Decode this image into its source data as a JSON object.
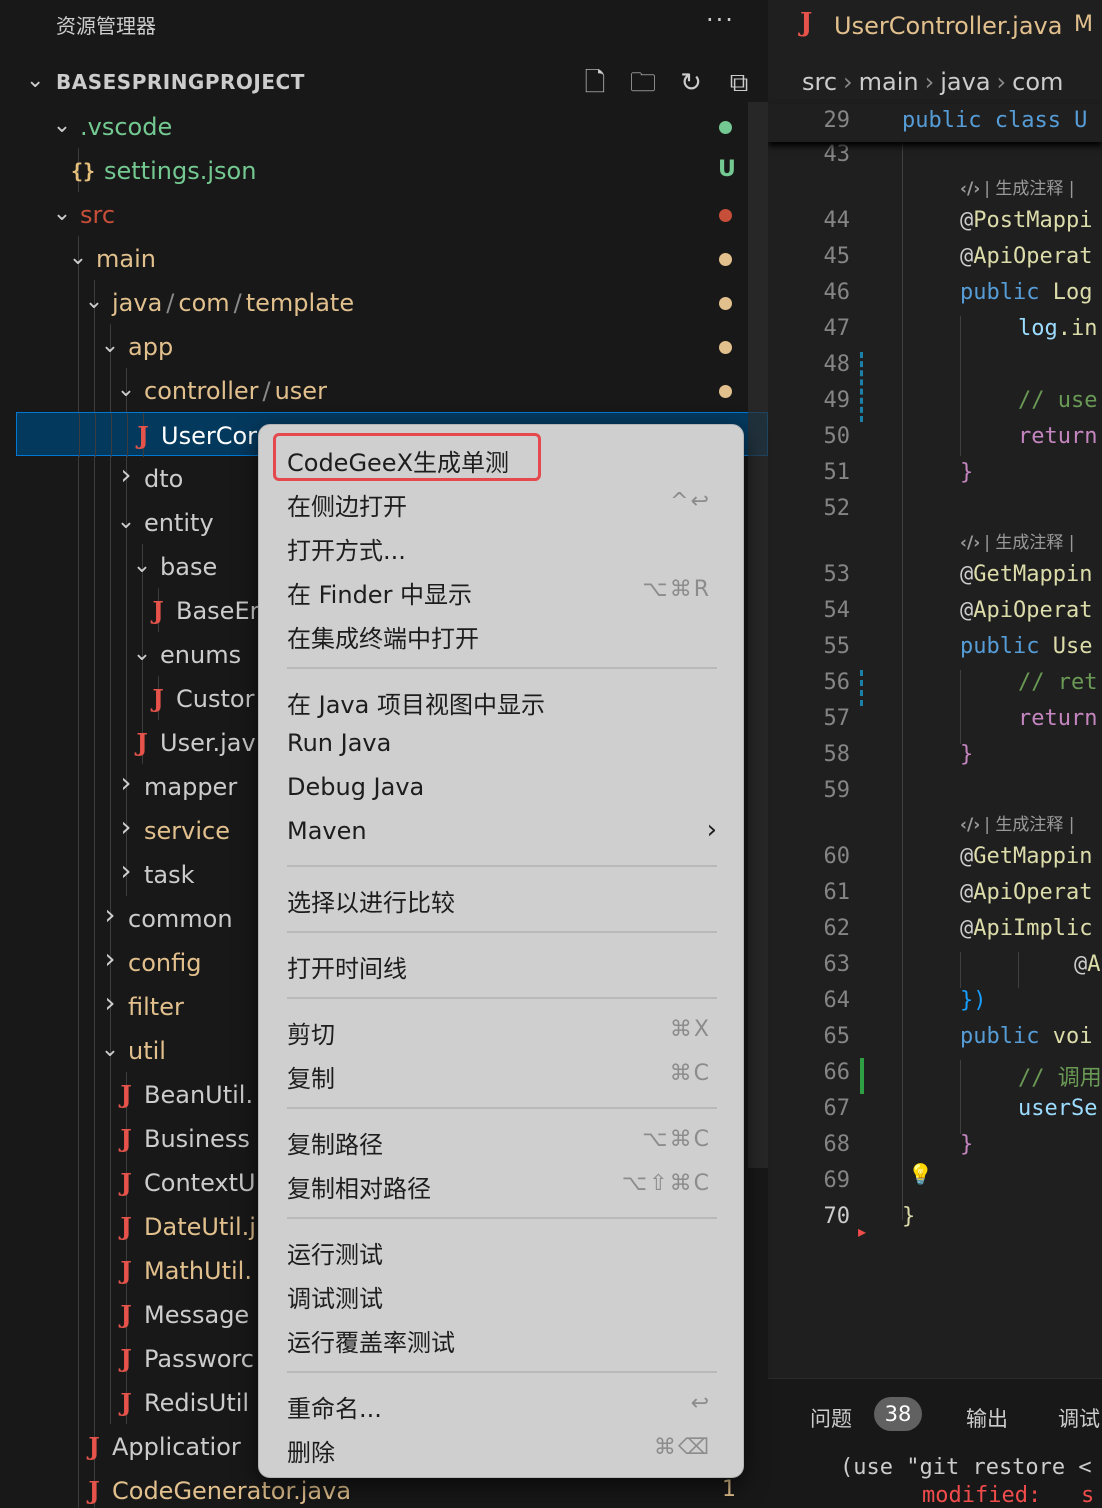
{
  "explorer": {
    "title": "资源管理器",
    "more": "···",
    "project": "BASESPRINGPROJECT",
    "actions": [
      "new-file-icon",
      "new-folder-icon",
      "refresh-icon",
      "collapse-all-icon"
    ],
    "tree": [
      {
        "label": ".vscode",
        "kind": "folder",
        "open": true,
        "status": "dot",
        "color": "#73c991"
      },
      {
        "label": "settings.json",
        "kind": "json",
        "status": "U",
        "color": "#73c991"
      },
      {
        "label": "src",
        "kind": "folder",
        "open": true,
        "status": "dot",
        "color": "#c74e39"
      },
      {
        "label": "main",
        "kind": "folder",
        "open": true,
        "status": "dot",
        "color": "#e2c08d"
      },
      {
        "label_parts": [
          "java",
          "com",
          "template"
        ],
        "kind": "folder",
        "open": true,
        "status": "dot",
        "color": "#e2c08d"
      },
      {
        "label": "app",
        "kind": "folder",
        "open": true,
        "status": "dot",
        "color": "#e2c08d"
      },
      {
        "label_parts": [
          "controller",
          "user"
        ],
        "kind": "folder",
        "open": true,
        "status": "dot",
        "color": "#e2c08d"
      },
      {
        "label": "UserCor",
        "kind": "java",
        "selected": true,
        "color": "#e2c08d"
      },
      {
        "label": "dto",
        "kind": "folder",
        "open": false,
        "color": "#cccccc"
      },
      {
        "label": "entity",
        "kind": "folder",
        "open": true,
        "color": "#cccccc"
      },
      {
        "label": "base",
        "kind": "folder",
        "open": true,
        "color": "#cccccc"
      },
      {
        "label": "BaseEr",
        "kind": "java",
        "color": "#cccccc"
      },
      {
        "label": "enums",
        "kind": "folder",
        "open": true,
        "color": "#cccccc"
      },
      {
        "label": "Custor",
        "kind": "java",
        "color": "#cccccc"
      },
      {
        "label": "User.jav",
        "kind": "java",
        "color": "#cccccc"
      },
      {
        "label": "mapper",
        "kind": "folder",
        "open": false,
        "color": "#cccccc"
      },
      {
        "label": "service",
        "kind": "folder",
        "open": false,
        "color": "#e2c08d"
      },
      {
        "label": "task",
        "kind": "folder",
        "open": false,
        "color": "#cccccc"
      },
      {
        "label": "common",
        "kind": "folder",
        "open": false,
        "color": "#cccccc"
      },
      {
        "label": "config",
        "kind": "folder",
        "open": false,
        "color": "#e2c08d"
      },
      {
        "label": "filter",
        "kind": "folder",
        "open": false,
        "color": "#e2c08d"
      },
      {
        "label": "util",
        "kind": "folder",
        "open": true,
        "color": "#e2c08d"
      },
      {
        "label": "BeanUtil.",
        "kind": "java",
        "color": "#cccccc"
      },
      {
        "label": "Business",
        "kind": "java",
        "color": "#cccccc"
      },
      {
        "label": "ContextU",
        "kind": "java",
        "color": "#cccccc"
      },
      {
        "label": "DateUtil.j",
        "kind": "java",
        "color": "#e2c08d"
      },
      {
        "label": "MathUtil.",
        "kind": "java",
        "color": "#e2c08d"
      },
      {
        "label": "Message",
        "kind": "java",
        "color": "#cccccc"
      },
      {
        "label": "Passworc",
        "kind": "java",
        "color": "#cccccc"
      },
      {
        "label": "RedisUtil",
        "kind": "java",
        "color": "#cccccc"
      },
      {
        "label": "Applicatior",
        "kind": "java",
        "color": "#cccccc"
      },
      {
        "label": "CodeGenerator.java",
        "kind": "java",
        "status": "1",
        "color": "#e2c08d"
      }
    ]
  },
  "editor": {
    "tab": {
      "name": "UserController.java",
      "modified": "M"
    },
    "breadcrumbs": [
      "src",
      "main",
      "java",
      "com"
    ],
    "sticky": {
      "line": "29",
      "code_kw": "public class U"
    },
    "lens_text": "| 生成注释 |",
    "lines": [
      {
        "n": "43"
      },
      {
        "n": "44",
        "code": "@PostMappi"
      },
      {
        "n": "45",
        "code": "@ApiOperat"
      },
      {
        "n": "46",
        "kw": "public",
        "code": " Log"
      },
      {
        "n": "47",
        "id": "log",
        "code": ".in"
      },
      {
        "n": "48"
      },
      {
        "n": "49",
        "comment": "// use"
      },
      {
        "n": "50",
        "ret": "return"
      },
      {
        "n": "51",
        "brace": "}"
      },
      {
        "n": "52"
      },
      {
        "n": "53",
        "code": "@GetMappin"
      },
      {
        "n": "54",
        "code": "@ApiOperat"
      },
      {
        "n": "55",
        "kw": "public",
        "code": " Use"
      },
      {
        "n": "56",
        "comment": "// ret"
      },
      {
        "n": "57",
        "ret": "return"
      },
      {
        "n": "58",
        "brace": "}"
      },
      {
        "n": "59"
      },
      {
        "n": "60",
        "code": "@GetMappin"
      },
      {
        "n": "61",
        "code": "@ApiOperat"
      },
      {
        "n": "62",
        "code": "@ApiImplic"
      },
      {
        "n": "63",
        "code": "@A"
      },
      {
        "n": "64",
        "brace": "})"
      },
      {
        "n": "65",
        "kw": "public",
        "code": " voi"
      },
      {
        "n": "66",
        "comment": "// 调用"
      },
      {
        "n": "67",
        "id": "userSe"
      },
      {
        "n": "68",
        "brace": "}"
      },
      {
        "n": "69"
      },
      {
        "n": "70",
        "brace": "}"
      }
    ]
  },
  "panel": {
    "tabs": [
      "问题",
      "输出",
      "调试"
    ],
    "problems_count": "38",
    "terminal_line1": "(use \"git restore <",
    "terminal_line2": "modified:   s"
  },
  "context_menu": {
    "items": [
      {
        "label": "CodeGeeX生成单测",
        "highlighted": true
      },
      {
        "label": "在侧边打开",
        "shortcut": "^↩"
      },
      {
        "label": "打开方式..."
      },
      {
        "label": "在 Finder 中显示",
        "shortcut": "⌥⌘R"
      },
      {
        "label": "在集成终端中打开"
      },
      {
        "separator": true
      },
      {
        "label": "在 Java 项目视图中显示"
      },
      {
        "label": "Run Java"
      },
      {
        "label": "Debug Java"
      },
      {
        "label": "Maven",
        "submenu": true
      },
      {
        "separator": true
      },
      {
        "label": "选择以进行比较"
      },
      {
        "separator": true
      },
      {
        "label": "打开时间线"
      },
      {
        "separator": true
      },
      {
        "label": "剪切",
        "shortcut": "⌘X"
      },
      {
        "label": "复制",
        "shortcut": "⌘C"
      },
      {
        "separator": true
      },
      {
        "label": "复制路径",
        "shortcut": "⌥⌘C"
      },
      {
        "label": "复制相对路径",
        "shortcut": "⌥⇧⌘C"
      },
      {
        "separator": true
      },
      {
        "label": "运行测试"
      },
      {
        "label": "调试测试"
      },
      {
        "label": "运行覆盖率测试"
      },
      {
        "separator": true
      },
      {
        "label": "重命名...",
        "shortcut": "↩"
      },
      {
        "label": "删除",
        "shortcut": "⌘⌫"
      }
    ]
  }
}
